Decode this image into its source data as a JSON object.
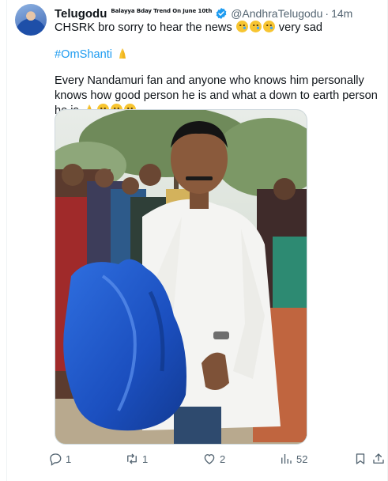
{
  "tweet": {
    "display_name": "Telugodu",
    "name_tagline": "Balayya Bday Trend On June 10th",
    "handle": "@AndhraTelugodu",
    "separator": "·",
    "time": "14m",
    "line1": "CHSRK bro sorry to hear the news",
    "line1_suffix": "very sad",
    "hashtag": "#OmShanti",
    "line3_a": "Every Nandamuri fan and anyone who knows him personally knows how",
    "line3_b": "good person he is and what a down to earth person he is"
  },
  "actions": {
    "reply_count": "1",
    "retweet_count": "1",
    "like_count": "2",
    "views_count": "52"
  },
  "icons": [
    "avatar",
    "verified-icon",
    "crying-face-emoji",
    "folded-hands-emoji",
    "reply-icon",
    "retweet-icon",
    "like-icon",
    "views-icon",
    "bookmark-icon",
    "share-icon"
  ],
  "colors": {
    "link": "#1d9bf0",
    "muted": "#536471",
    "text": "#0f1419",
    "verified": "#1d9bf0"
  }
}
